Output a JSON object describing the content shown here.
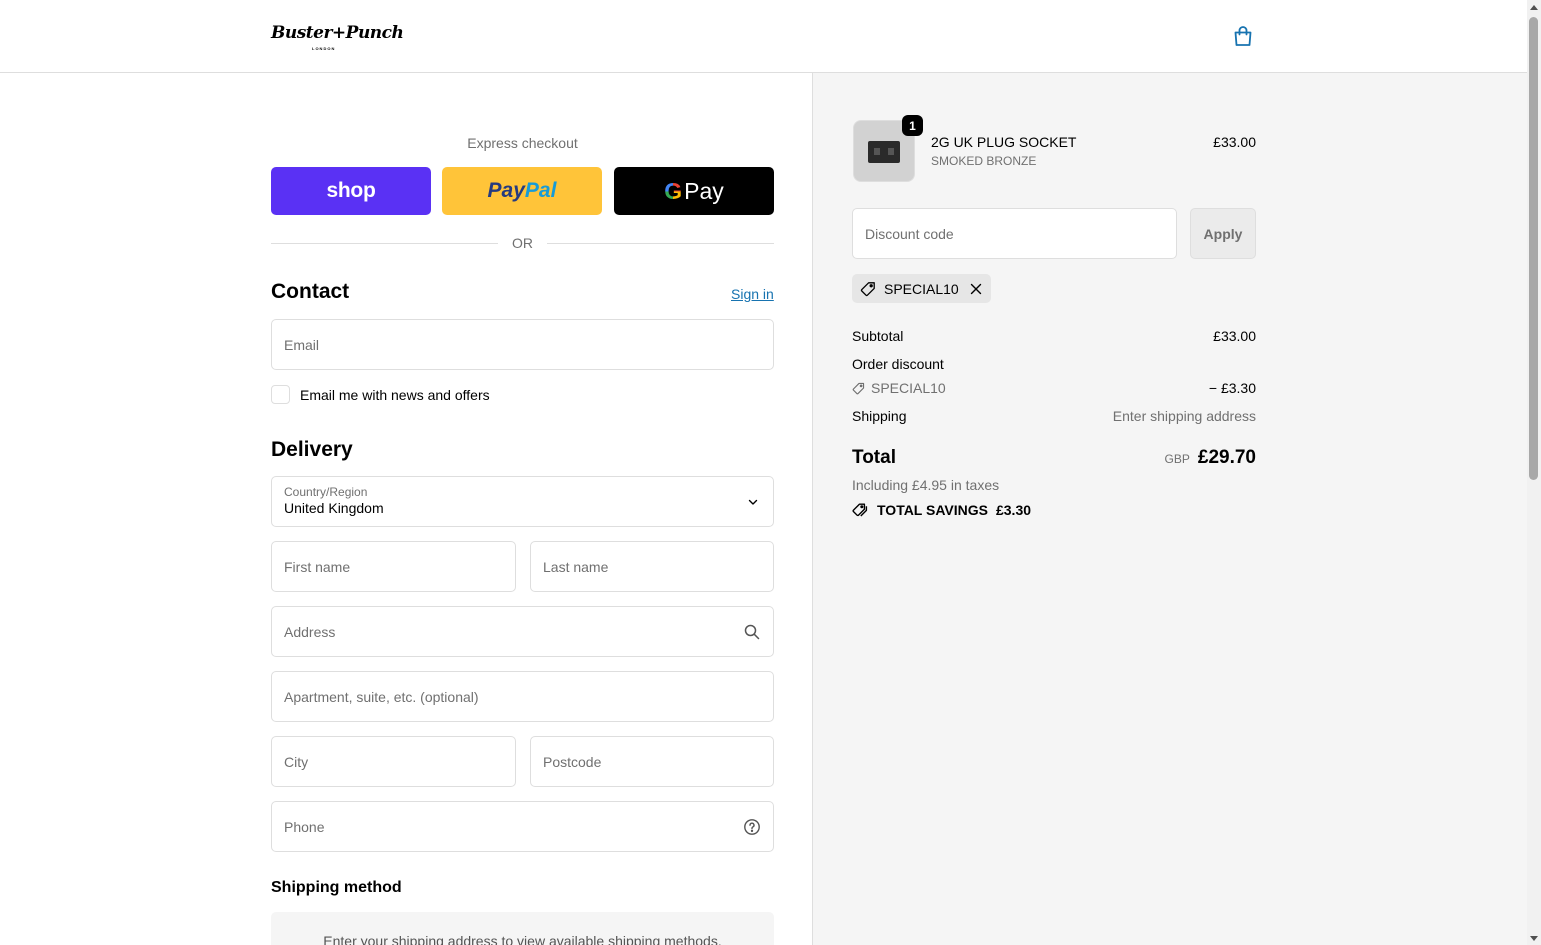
{
  "header": {
    "brand": "Buster+Punch",
    "brand_city": "LONDON",
    "cart_icon": "shopping-bag-icon"
  },
  "express": {
    "title": "Express checkout",
    "shop_label": "shop",
    "paypal_label_1": "Pay",
    "paypal_label_2": "Pal",
    "gpay_g": "G",
    "gpay_label": "Pay",
    "or_label": "OR"
  },
  "contact": {
    "title": "Contact",
    "sign_in": "Sign in",
    "email_placeholder": "Email",
    "newsletter_label": "Email me with news and offers"
  },
  "delivery": {
    "title": "Delivery",
    "country_label": "Country/Region",
    "country_value": "United Kingdom",
    "first_name_placeholder": "First name",
    "last_name_placeholder": "Last name",
    "address_placeholder": "Address",
    "apartment_placeholder": "Apartment, suite, etc. (optional)",
    "city_placeholder": "City",
    "postcode_placeholder": "Postcode",
    "phone_placeholder": "Phone"
  },
  "shipping_method": {
    "title": "Shipping method",
    "message": "Enter your shipping address to view available shipping methods."
  },
  "summary": {
    "product": {
      "name": "2G UK PLUG SOCKET",
      "variant": "SMOKED BRONZE",
      "price": "£33.00",
      "quantity": "1"
    },
    "discount_placeholder": "Discount code",
    "apply_label": "Apply",
    "applied_code": "SPECIAL10",
    "subtotal_label": "Subtotal",
    "subtotal_value": "£33.00",
    "order_discount_label": "Order discount",
    "discount_code": "SPECIAL10",
    "discount_value": "− £3.30",
    "shipping_label": "Shipping",
    "shipping_value": "Enter shipping address",
    "total_label": "Total",
    "currency": "GBP",
    "total_value": "£29.70",
    "tax_line": "Including £4.95 in taxes",
    "savings_label": "TOTAL SAVINGS",
    "savings_value": "£3.30"
  },
  "colors": {
    "shop_purple": "#5a31f4",
    "paypal_yellow": "#ffc439",
    "link_blue": "#1773b0"
  }
}
